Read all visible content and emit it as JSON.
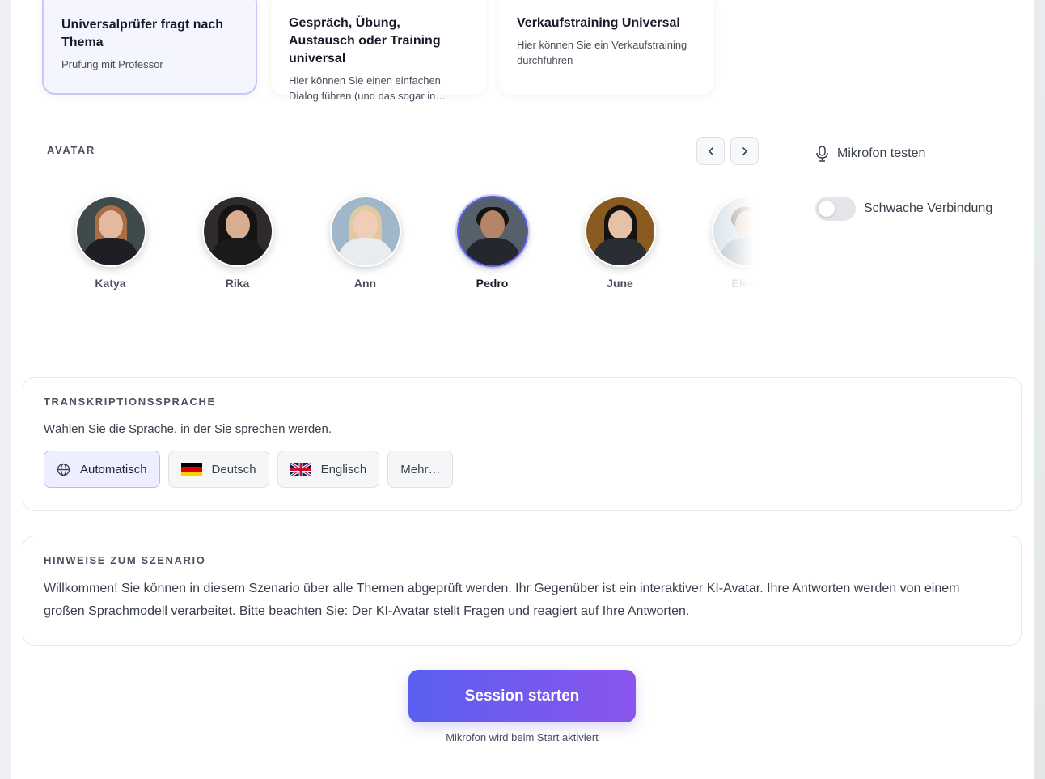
{
  "scenarios": [
    {
      "title": "Universalprüfer fragt nach Thema",
      "desc": "Prüfung mit Professor"
    },
    {
      "title": "Gespräch, Übung, Austausch oder Training universal",
      "desc": "Hier können Sie einen einfachen Dialog führen (und das sogar in…"
    },
    {
      "title": "Verkaufstraining Universal",
      "desc": "Hier können Sie ein Verkaufstraining durchführen"
    }
  ],
  "avatar_section": {
    "label": "AVATAR",
    "avatars": [
      {
        "name": "Katya",
        "bg": "#3f4a4c",
        "skin": "#e3b9a0",
        "hair": "#a86d45",
        "cloth": "#1d1f24"
      },
      {
        "name": "Rika",
        "bg": "#2e2b2a",
        "skin": "#d8ae92",
        "hair": "#151313",
        "cloth": "#1a1a1c"
      },
      {
        "name": "Ann",
        "bg": "#9fb7c8",
        "skin": "#f0cdb7",
        "hair": "#e0c9a0",
        "cloth": "#e8ecef"
      },
      {
        "name": "Pedro",
        "bg": "#56606a",
        "skin": "#b58366",
        "hair": "#161412",
        "cloth": "#24272e"
      },
      {
        "name": "June",
        "bg": "#8a5b20",
        "skin": "#e6c1a6",
        "hair": "#141212",
        "cloth": "#2a2d33"
      },
      {
        "name": "Eleno",
        "bg": "#cfdde8",
        "skin": "#e2c3ad",
        "hair": "#7a6a5a",
        "cloth": "#a9b6c2"
      }
    ]
  },
  "controls": {
    "mic_test": "Mikrofon testen",
    "weak_connection": "Schwache Verbindung"
  },
  "transcription": {
    "title": "TRANSKRIPTIONSSPRACHE",
    "desc": "Wählen Sie die Sprache, in der Sie sprechen werden.",
    "options": [
      "Automatisch",
      "Deutsch",
      "Englisch",
      "Mehr…"
    ],
    "selected": "Automatisch"
  },
  "hints": {
    "title": "HINWEISE ZUM SZENARIO",
    "text": "Willkommen! Sie können in diesem Szenario über alle Themen abgeprüft werden. Ihr Gegenüber ist ein interaktiver KI-Avatar. Ihre Antworten werden von einem großen Sprachmodell verarbeitet. Bitte beachten Sie: Der KI-Avatar stellt Fragen und reagiert auf Ihre Antworten."
  },
  "cta": {
    "label": "Session starten",
    "note": "Mikrofon wird beim Start aktiviert"
  }
}
